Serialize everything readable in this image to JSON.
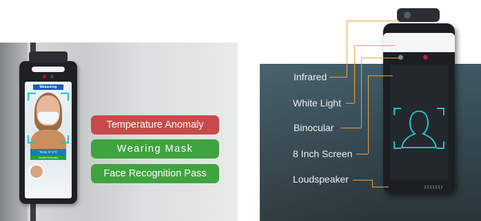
{
  "left_panel": {
    "screen": {
      "measuring": "Measuring",
      "temp": "Temp 37.5°C",
      "health": "Health Detected"
    },
    "tags": {
      "temperature_anomaly": "Temperature Anomaly",
      "wearing_mask": "Wearing Mask",
      "face_recognition_pass": "Face Recognition Pass"
    },
    "colors": {
      "anomaly": "#c84a4a",
      "pass": "#3fa33f"
    }
  },
  "right_panel": {
    "labels": {
      "infrared": "Infrared",
      "white_light": "White Light",
      "binocular": "Binocular",
      "screen": "8 Inch Screen",
      "loudspeaker": "Loudspeaker"
    },
    "colors": {
      "callout_line": "#f0a33a",
      "face_outline": "#28c1c9"
    }
  }
}
